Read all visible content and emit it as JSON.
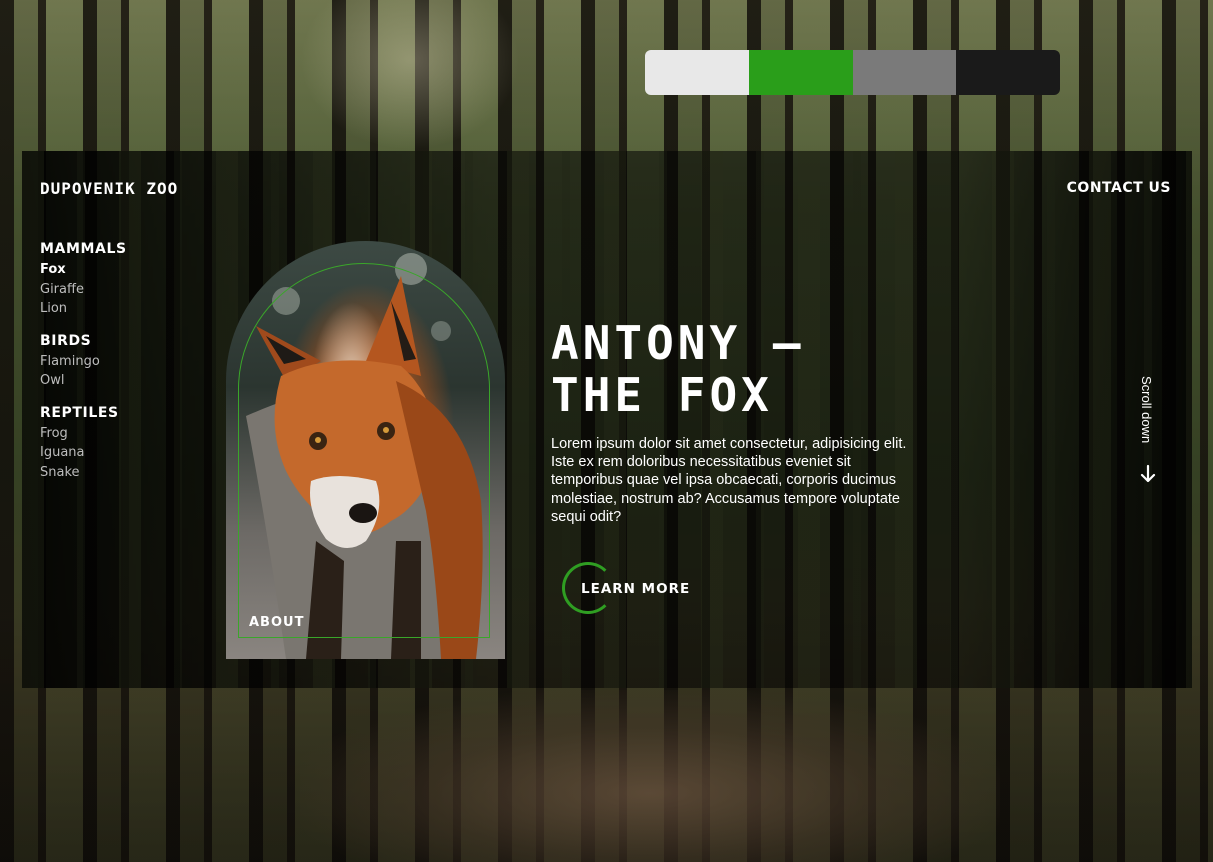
{
  "swatches": [
    "#e8e8e8",
    "#2a9e1a",
    "#7a7a7a",
    "#1a1a1a"
  ],
  "header": {
    "logo": "DUPOVENIK ZOO",
    "contact": "CONTACT US"
  },
  "nav": {
    "groups": [
      {
        "heading": "MAMMALS",
        "items": [
          "Fox",
          "Giraffe",
          "Lion"
        ]
      },
      {
        "heading": "BIRDS",
        "items": [
          "Flamingo",
          "Owl"
        ]
      },
      {
        "heading": "REPTILES",
        "items": [
          "Frog",
          "Iguana",
          "Snake"
        ]
      }
    ],
    "active_item": "Fox"
  },
  "hero": {
    "title_line1": "ANTONY –",
    "title_line2": "THE FOX",
    "body": "Lorem ipsum dolor sit amet consectetur, adipisicing elit. Iste ex rem doloribus necessitatibus eveniet sit temporibus quae vel ipsa obcaecati, corporis ducimus molestiae, nostrum ab? Accusamus tempore voluptate sequi odit?",
    "learn_more": "LEARN MORE",
    "about": "ABOUT",
    "scroll_down": "Scroll down"
  },
  "icons": {
    "scroll": "arrow-down-icon"
  },
  "colors": {
    "accent": "#2f9e22",
    "text": "#ffffff",
    "muted": "#bdbdbd"
  }
}
